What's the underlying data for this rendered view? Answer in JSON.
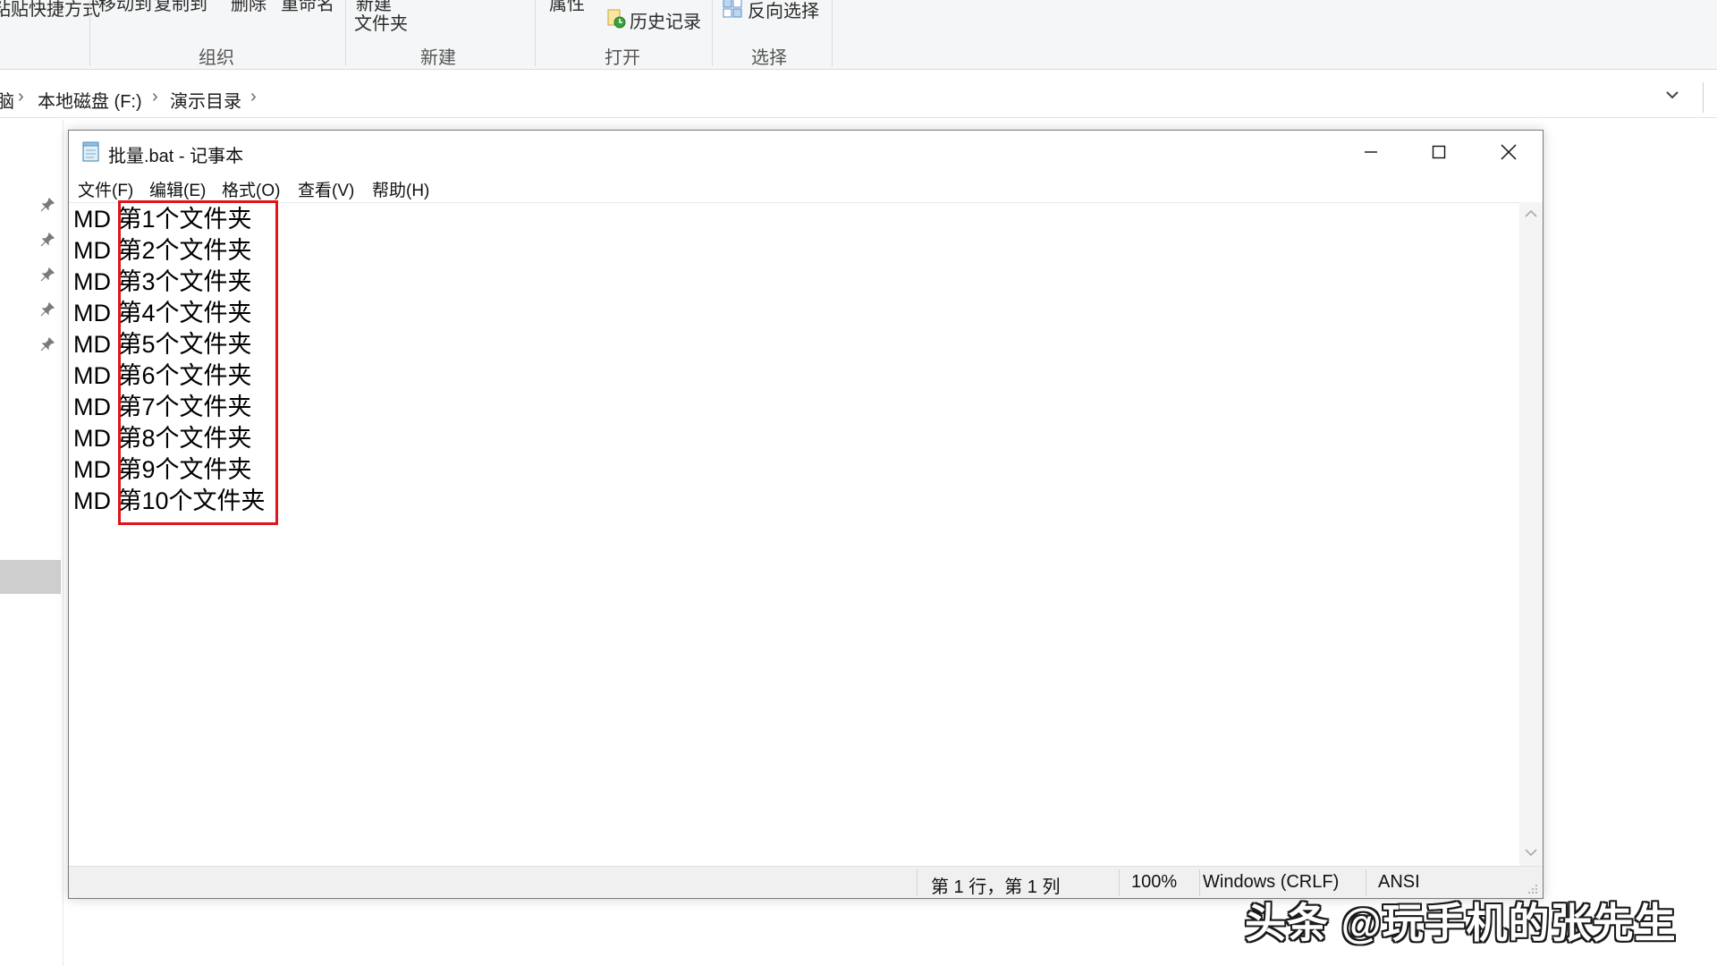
{
  "explorer": {
    "ribbon": {
      "clipped_labels": {
        "paste_shortcut": "粘贴快捷方式",
        "move_to": "移动到",
        "copy_to": "复制到",
        "delete": "删除",
        "rename": "重命名",
        "new": "新建",
        "properties": "属性"
      },
      "new_folder_label": "文件夹",
      "history_label": "历史记录",
      "invert_selection_label": "反向选择",
      "groups": {
        "organize": "组织",
        "new": "新建",
        "open": "打开",
        "select": "选择"
      }
    },
    "breadcrumb": {
      "partial_first": "脑",
      "items": [
        "本地磁盘 (F:)",
        "演示目录"
      ],
      "separator": "›"
    }
  },
  "notepad": {
    "title": "批量.bat - 记事本",
    "menu": [
      "文件(F)",
      "编辑(E)",
      "格式(O)",
      "查看(V)",
      "帮助(H)"
    ],
    "lines": [
      "MD 第1个文件夹",
      "MD 第2个文件夹",
      "MD 第3个文件夹",
      "MD 第4个文件夹",
      "MD 第5个文件夹",
      "MD 第6个文件夹",
      "MD 第7个文件夹",
      "MD 第8个文件夹",
      "MD 第9个文件夹",
      "MD 第10个文件夹"
    ],
    "highlight_color": "#e0151b",
    "status": {
      "position": "第 1 行，第 1 列",
      "zoom": "100%",
      "line_ending": "Windows (CRLF)",
      "encoding": "ANSI"
    }
  },
  "watermark": "头条 @玩手机的张先生"
}
